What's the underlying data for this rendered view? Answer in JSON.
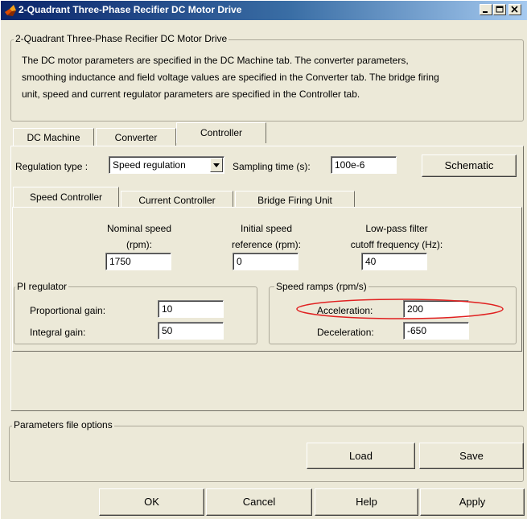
{
  "window": {
    "title": "2-Quadrant Three-Phase Recifier DC Motor Drive",
    "icon": "matlab-icon",
    "controls": [
      "minimize-icon",
      "maximize-icon",
      "close-icon"
    ]
  },
  "main_group": {
    "legend": "2-Quadrant Three-Phase Recifier DC Motor Drive",
    "description_lines": [
      "The DC motor parameters are specified in the DC Machine tab. The converter parameters,",
      "smoothing inductance and field voltage values are specified in the Converter tab. The bridge firing",
      "unit, speed and current regulator parameters are specified in the Controller tab."
    ]
  },
  "main_tabs": [
    {
      "label": "DC Machine",
      "active": false
    },
    {
      "label": "Converter",
      "active": false
    },
    {
      "label": "Controller",
      "active": true
    }
  ],
  "controller": {
    "regulation_type_label": "Regulation type :",
    "regulation_type_value": "Speed regulation",
    "sampling_time_label": "Sampling time (s):",
    "sampling_time_value": "100e-6",
    "schematic_label": "Schematic"
  },
  "sub_tabs": [
    {
      "label": "Speed Controller",
      "active": true
    },
    {
      "label": "Current Controller",
      "active": false
    },
    {
      "label": "Bridge Firing Unit",
      "active": false
    }
  ],
  "speed_controller": {
    "nominal_speed": {
      "label_line1": "Nominal speed",
      "label_line2": "(rpm):",
      "value": "1750"
    },
    "initial_speed": {
      "label_line1": "Initial speed",
      "label_line2": "reference (rpm):",
      "value": "0"
    },
    "lowpass": {
      "label_line1": "Low-pass filter",
      "label_line2": "cutoff frequency (Hz):",
      "value": "40"
    },
    "pi_regulator": {
      "legend": "PI regulator",
      "proportional_label": "Proportional gain:",
      "proportional_value": "10",
      "integral_label": "Integral gain:",
      "integral_value": "50"
    },
    "speed_ramps": {
      "legend": "Speed ramps (rpm/s)",
      "acceleration_label": "Acceleration:",
      "acceleration_value": "200",
      "deceleration_label": "Deceleration:",
      "deceleration_value": "-650",
      "highlight_color": "#e02020"
    }
  },
  "parameters_file": {
    "legend": "Parameters file options",
    "load_label": "Load",
    "save_label": "Save"
  },
  "footer_buttons": {
    "ok": "OK",
    "cancel": "Cancel",
    "help": "Help",
    "apply": "Apply"
  }
}
